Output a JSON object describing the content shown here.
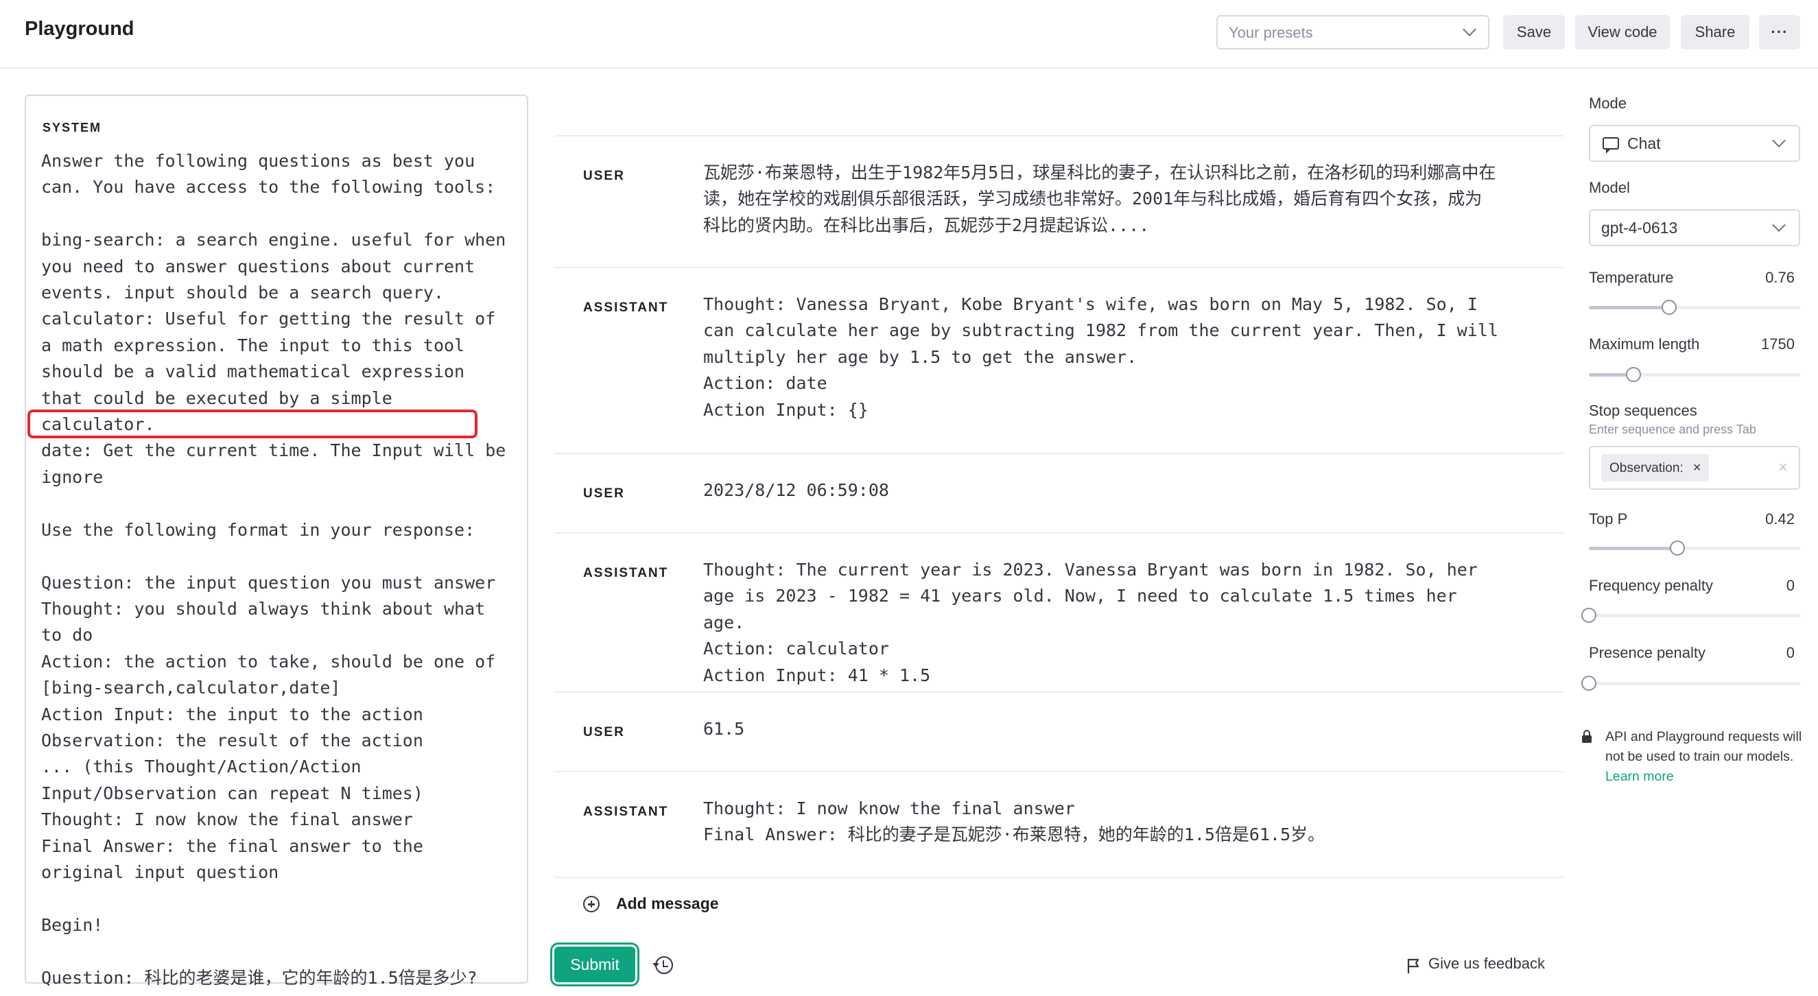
{
  "header": {
    "title": "Playground",
    "presets_placeholder": "Your presets",
    "save_label": "Save",
    "view_code_label": "View code",
    "share_label": "Share",
    "more_label": "···"
  },
  "system": {
    "label": "SYSTEM",
    "text": "Answer the following questions as best you can. You have access to the following tools:\n\nbing-search: a search engine. useful for when you need to answer questions about current events. input should be a search query.\ncalculator: Useful for getting the result of a math expression. The input to this tool should be a valid mathematical expression that could be executed by a simple calculator.\ndate: Get the current time. The Input will be ignore\n\nUse the following format in your response:\n\nQuestion: the input question you must answer\nThought: you should always think about what to do\nAction: the action to take, should be one of [bing-search,calculator,date]\nAction Input: the input to the action\nObservation: the result of the action\n... (this Thought/Action/Action Input/Observation can repeat N times)\nThought: I now know the final answer\nFinal Answer: the final answer to the original input question\n\nBegin!\n\nQuestion: 科比的老婆是谁，它的年龄的1.5倍是多少?"
  },
  "messages": [
    {
      "role": "USER",
      "content": "瓦妮莎·布莱恩特，出生于1982年5月5日，球星科比的妻子，在认识科比之前，在洛杉矶的玛利娜高中在读，她在学校的戏剧俱乐部很活跃，学习成绩也非常好。2001年与科比成婚，婚后育有四个女孩，成为科比的贤内助。在科比出事后，瓦妮莎于2月提起诉讼...."
    },
    {
      "role": "ASSISTANT",
      "content": "Thought: Vanessa Bryant, Kobe Bryant's wife, was born on May 5, 1982. So, I can calculate her age by subtracting 1982 from the current year. Then, I will multiply her age by 1.5 to get the answer.\nAction: date\nAction Input: {}"
    },
    {
      "role": "USER",
      "content": "2023/8/12 06:59:08"
    },
    {
      "role": "ASSISTANT",
      "content": "Thought: The current year is 2023. Vanessa Bryant was born in 1982. So, her age is 2023 - 1982 = 41 years old. Now, I need to calculate 1.5 times her age.\nAction: calculator\nAction Input: 41 * 1.5"
    },
    {
      "role": "USER",
      "content": "61.5"
    },
    {
      "role": "ASSISTANT",
      "content": "Thought: I now know the final answer\nFinal Answer: 科比的妻子是瓦妮莎·布莱恩特，她的年龄的1.5倍是61.5岁。"
    }
  ],
  "chat_actions": {
    "add_message_label": "Add message",
    "submit_label": "Submit",
    "feedback_label": "Give us feedback"
  },
  "settings": {
    "mode": {
      "label": "Mode",
      "value": "Chat"
    },
    "model": {
      "label": "Model",
      "value": "gpt-4-0613"
    },
    "temperature": {
      "label": "Temperature",
      "value": "0.76",
      "fraction": 0.38
    },
    "max_length": {
      "label": "Maximum length",
      "value": "1750",
      "fraction": 0.21
    },
    "stop_sequences": {
      "label": "Stop sequences",
      "hint": "Enter sequence and press Tab",
      "chip": "Observation:",
      "chip_remove": "×",
      "clear": "×"
    },
    "top_p": {
      "label": "Top P",
      "value": "0.42",
      "fraction": 0.42
    },
    "frequency_penalty": {
      "label": "Frequency penalty",
      "value": "0",
      "fraction": 0
    },
    "presence_penalty": {
      "label": "Presence penalty",
      "value": "0",
      "fraction": 0
    },
    "notice": "API and Playground requests will not be used to train our models.",
    "learn_more": "Learn more"
  },
  "colors": {
    "accent": "#10a37f",
    "highlight": "#e8262c"
  }
}
